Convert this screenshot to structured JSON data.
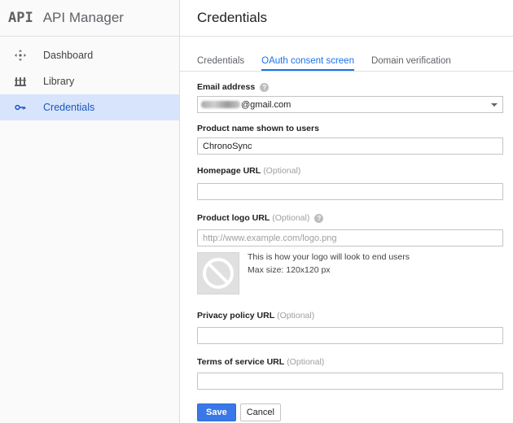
{
  "app": {
    "logo_text": "API",
    "title": "API Manager"
  },
  "sidebar": {
    "items": [
      {
        "label": "Dashboard",
        "icon": "dashboard-icon",
        "active": false
      },
      {
        "label": "Library",
        "icon": "library-icon",
        "active": false
      },
      {
        "label": "Credentials",
        "icon": "key-icon",
        "active": true
      }
    ]
  },
  "page": {
    "title": "Credentials"
  },
  "tabs": [
    {
      "label": "Credentials",
      "active": false
    },
    {
      "label": "OAuth consent screen",
      "active": true
    },
    {
      "label": "Domain verification",
      "active": false
    }
  ],
  "form": {
    "email": {
      "label": "Email address",
      "value_suffix": "@gmail.com",
      "help": "?"
    },
    "product_name": {
      "label": "Product name shown to users",
      "value": "ChronoSync"
    },
    "homepage": {
      "label": "Homepage URL",
      "optional": "(Optional)",
      "value": ""
    },
    "logo_url": {
      "label": "Product logo URL",
      "optional": "(Optional)",
      "placeholder": "http://www.example.com/logo.png",
      "help": "?"
    },
    "logo_preview": {
      "line1": "This is how your logo will look to end users",
      "line2": "Max size: 120x120 px",
      "icon": "no-image-icon"
    },
    "privacy": {
      "label": "Privacy policy URL",
      "optional": "(Optional)",
      "value": ""
    },
    "terms": {
      "label": "Terms of service URL",
      "optional": "(Optional)",
      "value": ""
    }
  },
  "buttons": {
    "save": "Save",
    "cancel": "Cancel"
  },
  "colors": {
    "accent": "#1a73e8",
    "save_button": "#3b78e7",
    "active_nav_bg": "#d8e4fb"
  }
}
